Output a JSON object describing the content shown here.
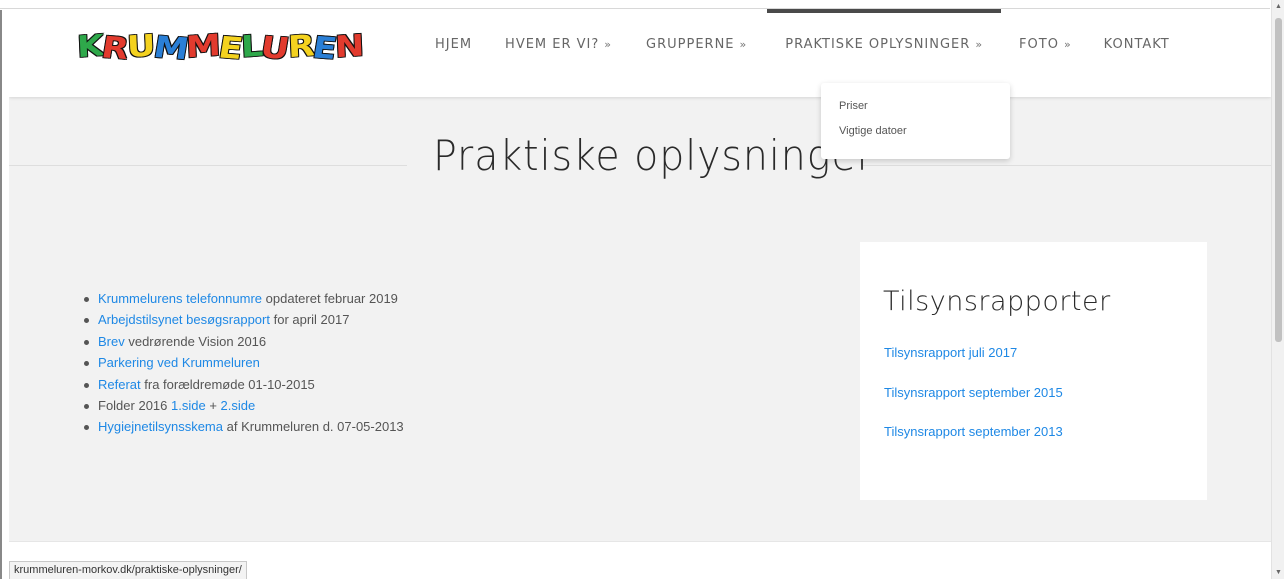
{
  "header": {
    "logo_letters": [
      "K",
      "R",
      "U",
      "M",
      "M",
      "E",
      "L",
      "U",
      "R",
      "E",
      "N"
    ],
    "logo_colors": [
      "#2ea84a",
      "#e23b2e",
      "#f4d21f",
      "#2a7fd6",
      "#e23b2e",
      "#f4d21f",
      "#2ea84a",
      "#e23b2e",
      "#f4d21f",
      "#2a7fd6",
      "#e23b2e"
    ]
  },
  "nav": {
    "items": [
      {
        "label": "HJEM",
        "has_dropdown": false,
        "active": false
      },
      {
        "label": "HVEM ER VI?",
        "has_dropdown": true,
        "active": false
      },
      {
        "label": "GRUPPERNE",
        "has_dropdown": true,
        "active": false
      },
      {
        "label": "PRAKTISKE OPLYSNINGER",
        "has_dropdown": true,
        "active": true
      },
      {
        "label": "FOTO",
        "has_dropdown": true,
        "active": false
      },
      {
        "label": "KONTAKT",
        "has_dropdown": false,
        "active": false
      }
    ],
    "chevron_glyph": "»",
    "dropdown": [
      "Priser",
      "Vigtige datoer"
    ]
  },
  "page_title": "Praktiske oplysninger",
  "list": {
    "items": [
      {
        "link": "Krummelurens telefonnumre",
        "text": " opdateret februar 2019"
      },
      {
        "link": "Arbejdstilsynet besøgsrapport",
        "text": " for april 2017"
      },
      {
        "link": "Brev",
        "text": " vedrørende Vision 2016"
      },
      {
        "link": "Parkering ved Krummeluren",
        "text": ""
      },
      {
        "link": "Referat",
        "text": " fra forældremøde 01-10-2015"
      },
      {
        "prefix": "Folder 2016 ",
        "link": "1.side",
        "middle": " + ",
        "link2": "2.side"
      },
      {
        "link": "Hygiejnetilsynsskema",
        "text": " af Krummeluren d. 07-05-2013"
      }
    ]
  },
  "sidebar": {
    "title": "Tilsynsrapporter",
    "links": [
      "Tilsynsrapport juli 2017",
      "Tilsynsrapport september 2015",
      "Tilsynsrapport september 2013"
    ]
  },
  "status_bar": {
    "url": "krummeluren-morkov.dk/praktiske-oplysninger/"
  },
  "colors": {
    "link": "#1e88e5",
    "page_bg": "#f2f2f2",
    "active_bar": "#4a4a4a"
  }
}
